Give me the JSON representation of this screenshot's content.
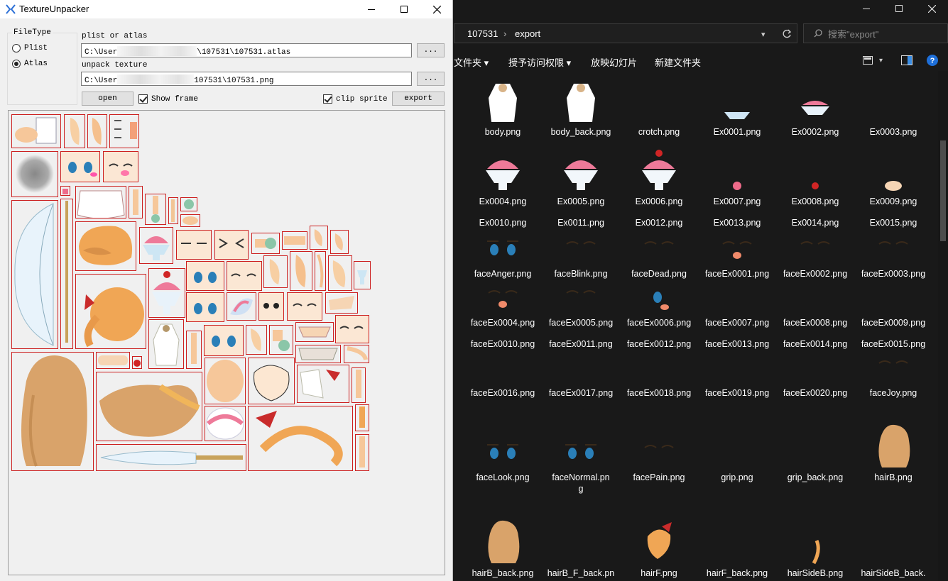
{
  "unpacker": {
    "title": "TextureUnpacker",
    "filetype_label": "FileType",
    "radio_plist": "Plist",
    "radio_atlas": "Atlas",
    "radio_selected": "Atlas",
    "plist_label": "plist or atlas",
    "plist_prefix": "C:\\User",
    "plist_suffix": "\\107531\\107531.atlas",
    "texture_label": "unpack texture",
    "texture_prefix": "C:\\User",
    "texture_suffix": "107531\\107531.png",
    "browse_label": "...",
    "open_label": "open",
    "show_frame_label": "Show frame",
    "show_frame_checked": true,
    "clip_sprite_label": "clip sprite",
    "clip_sprite_checked": true,
    "export_label": "export"
  },
  "explorer": {
    "breadcrumb": [
      "107531",
      "export"
    ],
    "search_placeholder": "搜索\"export\"",
    "ribbon": [
      "文件夹 ▾",
      "授予访问权限 ▾",
      "放映幻灯片",
      "新建文件夹"
    ],
    "files": [
      "body.png",
      "body_back.png",
      "crotch.png",
      "Ex0001.png",
      "Ex0002.png",
      "Ex0003.png",
      "Ex0004.png",
      "Ex0005.png",
      "Ex0006.png",
      "Ex0007.png",
      "Ex0008.png",
      "Ex0009.png",
      "Ex0010.png",
      "Ex0011.png",
      "Ex0012.png",
      "Ex0013.png",
      "Ex0014.png",
      "Ex0015.png",
      "faceAnger.png",
      "faceBlink.png",
      "faceDead.png",
      "faceEx0001.png",
      "faceEx0002.png",
      "faceEx0003.png",
      "faceEx0004.png",
      "faceEx0005.png",
      "faceEx0006.png",
      "faceEx0007.png",
      "faceEx0008.png",
      "faceEx0009.png",
      "faceEx0010.png",
      "faceEx0011.png",
      "faceEx0012.png",
      "faceEx0013.png",
      "faceEx0014.png",
      "faceEx0015.png",
      "faceEx0016.png",
      "faceEx0017.png",
      "faceEx0018.png",
      "faceEx0019.png",
      "faceEx0020.png",
      "faceJoy.png",
      "faceLook.png",
      "faceNormal.pn\ng",
      "facePain.png",
      "grip.png",
      "grip_back.png",
      "hairB.png",
      "hairB_back.png",
      "hairB_F_back.pn",
      "hairF.png",
      "hairF_back.png",
      "hairSideB.png",
      "hairSideB_back."
    ]
  },
  "colors": {
    "frame_red": "#cc1f1f",
    "explorer_bg": "#191919",
    "help_blue": "#1e6fd9"
  }
}
